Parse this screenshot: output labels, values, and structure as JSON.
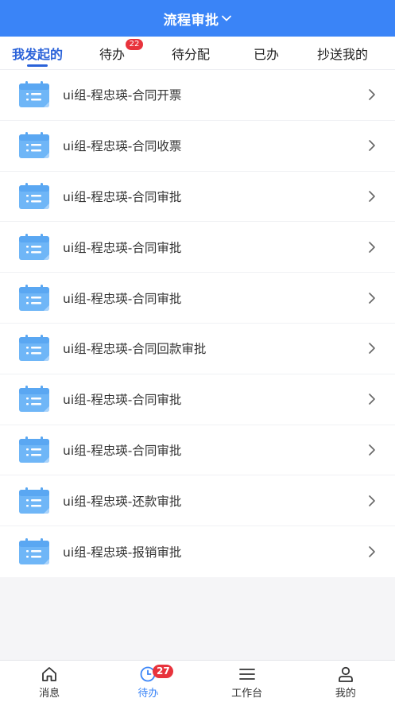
{
  "header": {
    "title": "流程审批"
  },
  "tabs": [
    {
      "label": "我发起的",
      "active": true
    },
    {
      "label": "待办",
      "badge": "22"
    },
    {
      "label": "待分配"
    },
    {
      "label": "已办"
    },
    {
      "label": "抄送我的"
    }
  ],
  "list": {
    "items": [
      {
        "label": "ui组-程忠瑛-合同开票"
      },
      {
        "label": "ui组-程忠瑛-合同收票"
      },
      {
        "label": "ui组-程忠瑛-合同审批"
      },
      {
        "label": "ui组-程忠瑛-合同审批"
      },
      {
        "label": "ui组-程忠瑛-合同审批"
      },
      {
        "label": "ui组-程忠瑛-合同回款审批"
      },
      {
        "label": "ui组-程忠瑛-合同审批"
      },
      {
        "label": "ui组-程忠瑛-合同审批"
      },
      {
        "label": "ui组-程忠瑛-还款审批"
      },
      {
        "label": "ui组-程忠瑛-报销审批"
      }
    ]
  },
  "bottom_nav": [
    {
      "label": "消息",
      "icon": "home-icon"
    },
    {
      "label": "待办",
      "icon": "clock-icon",
      "badge": "27",
      "active": true
    },
    {
      "label": "工作台",
      "icon": "menu-icon"
    },
    {
      "label": "我的",
      "icon": "user-icon"
    }
  ],
  "colors": {
    "primary": "#3a84f7",
    "tab_active": "#2a62d9",
    "badge": "#e8333c",
    "icon_blue": "#6fb6f7"
  }
}
